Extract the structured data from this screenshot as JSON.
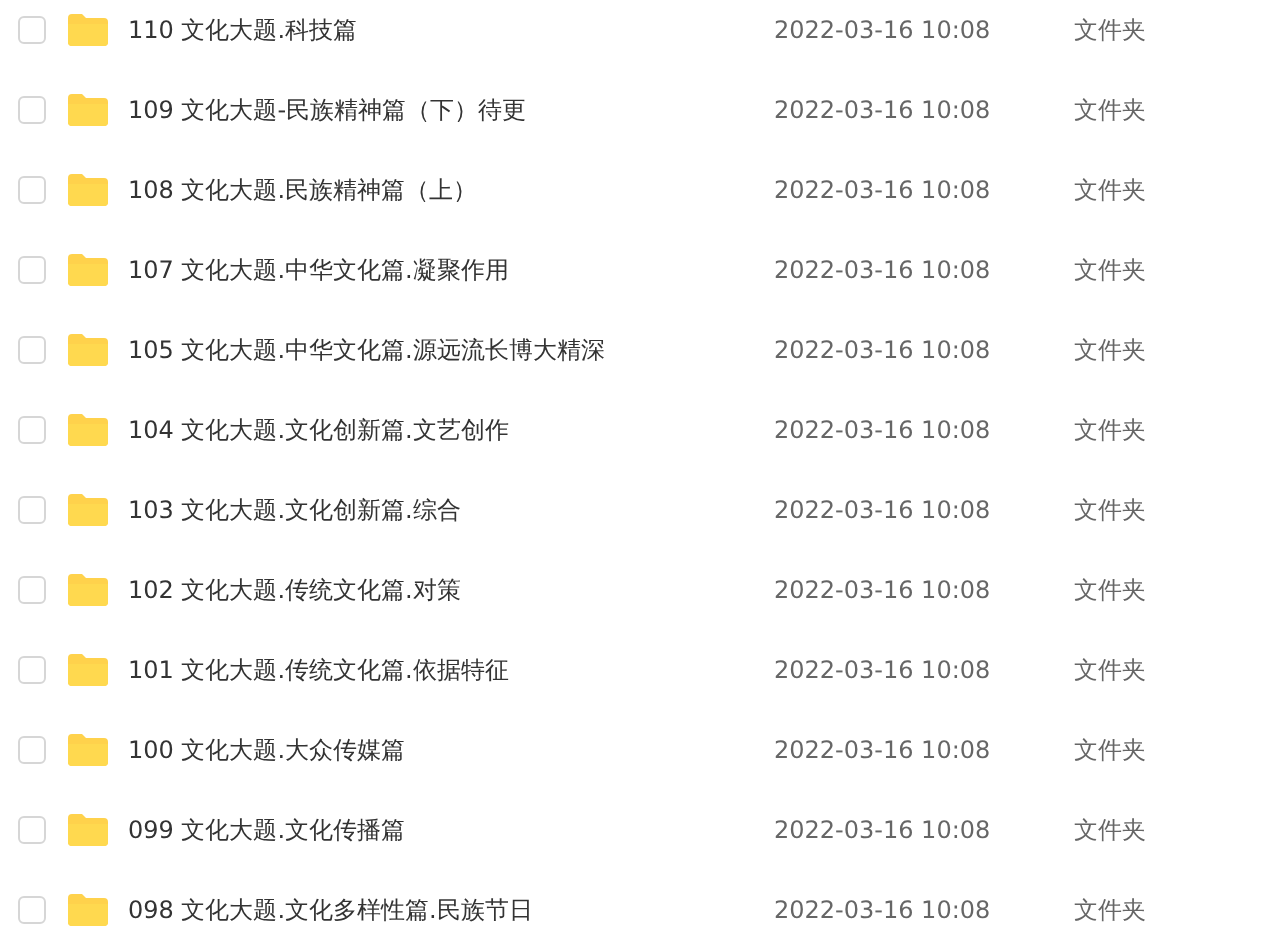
{
  "files": [
    {
      "name": "110 文化大题.科技篇",
      "modified": "2022-03-16 10:08",
      "type": "文件夹",
      "checked": false
    },
    {
      "name": "109 文化大题-民族精神篇（下）待更",
      "modified": "2022-03-16 10:08",
      "type": "文件夹",
      "checked": false
    },
    {
      "name": "108 文化大题.民族精神篇（上）",
      "modified": "2022-03-16 10:08",
      "type": "文件夹",
      "checked": false
    },
    {
      "name": "107 文化大题.中华文化篇.凝聚作用",
      "modified": "2022-03-16 10:08",
      "type": "文件夹",
      "checked": false
    },
    {
      "name": "105 文化大题.中华文化篇.源远流长博大精深",
      "modified": "2022-03-16 10:08",
      "type": "文件夹",
      "checked": false
    },
    {
      "name": "104 文化大题.文化创新篇.文艺创作",
      "modified": "2022-03-16 10:08",
      "type": "文件夹",
      "checked": false
    },
    {
      "name": "103 文化大题.文化创新篇.综合",
      "modified": "2022-03-16 10:08",
      "type": "文件夹",
      "checked": false
    },
    {
      "name": "102 文化大题.传统文化篇.对策",
      "modified": "2022-03-16 10:08",
      "type": "文件夹",
      "checked": false
    },
    {
      "name": "101 文化大题.传统文化篇.依据特征",
      "modified": "2022-03-16 10:08",
      "type": "文件夹",
      "checked": false
    },
    {
      "name": "100 文化大题.大众传媒篇",
      "modified": "2022-03-16 10:08",
      "type": "文件夹",
      "checked": false
    },
    {
      "name": "099 文化大题.文化传播篇",
      "modified": "2022-03-16 10:08",
      "type": "文件夹",
      "checked": false
    },
    {
      "name": "098 文化大题.文化多样性篇.民族节日",
      "modified": "2022-03-16 10:08",
      "type": "文件夹",
      "checked": false
    }
  ]
}
